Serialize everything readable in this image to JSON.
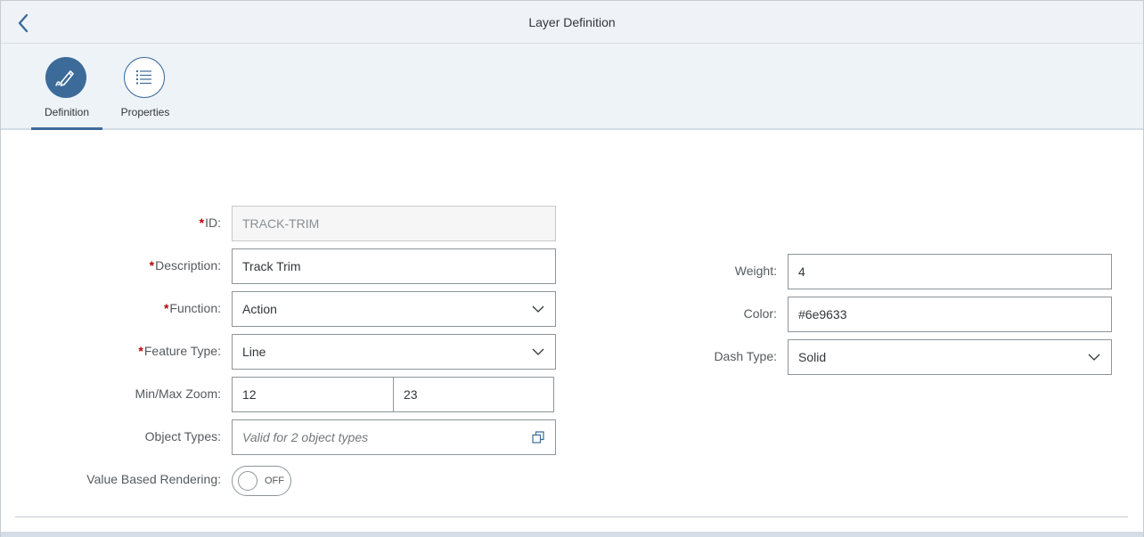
{
  "header": {
    "title": "Layer Definition",
    "back_icon": "chevron-left-icon"
  },
  "tabs": [
    {
      "label": "Definition",
      "icon": "pencil-icon",
      "selected": true
    },
    {
      "label": "Properties",
      "icon": "list-icon",
      "selected": false
    }
  ],
  "form": {
    "required_marker": "*",
    "id": {
      "label": "ID:",
      "value": "TRACK-TRIM",
      "required": true,
      "editable": false
    },
    "description": {
      "label": "Description:",
      "value": "Track Trim",
      "required": true
    },
    "function": {
      "label": "Function:",
      "value": "Action",
      "required": true
    },
    "feature_type": {
      "label": "Feature Type:",
      "value": "Line",
      "required": true
    },
    "zoom": {
      "label": "Min/Max Zoom:",
      "min": "12",
      "max": "23"
    },
    "object_types": {
      "label": "Object Types:",
      "placeholder": "Valid for 2 object types",
      "icon": "value-help-icon"
    },
    "value_based_rendering": {
      "label": "Value Based Rendering:",
      "state": "OFF"
    },
    "weight": {
      "label": "Weight:",
      "value": "4"
    },
    "color": {
      "label": "Color:",
      "value": "#6e9633"
    },
    "dash_type": {
      "label": "Dash Type:",
      "value": "Solid"
    }
  },
  "colors": {
    "accent": "#3c6b9a",
    "required": "#bb0000",
    "header_bg": "#eff3f7"
  }
}
